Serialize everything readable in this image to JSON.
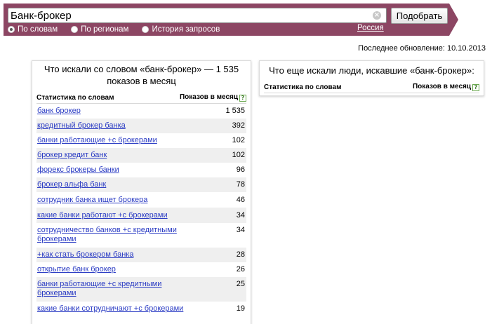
{
  "search": {
    "query": "Банк-брокер",
    "submit_label": "Подобрать",
    "modes": [
      {
        "label": "По словам",
        "selected": true
      },
      {
        "label": "По регионам",
        "selected": false
      },
      {
        "label": "История запросов",
        "selected": false
      }
    ],
    "region": "Россия"
  },
  "updated": "Последнее обновление: 10.10.2013",
  "main_panel": {
    "title": "Что искали со словом «банк-брокер» — 1 535 показов в месяц",
    "col_keywords": "Статистика по словам",
    "col_impressions": "Показов в месяц",
    "rows": [
      {
        "keyword": "банк брокер",
        "count": "1 535"
      },
      {
        "keyword": "кредитный брокер банка",
        "count": "392"
      },
      {
        "keyword": "банки работающие +с брокерами",
        "count": "102"
      },
      {
        "keyword": "брокер кредит банк",
        "count": "102"
      },
      {
        "keyword": "форекс брокеры банки",
        "count": "96"
      },
      {
        "keyword": "брокер альфа банк",
        "count": "78"
      },
      {
        "keyword": "сотрудник банка ищет брокера",
        "count": "46"
      },
      {
        "keyword": "какие банки работают +с брокерами",
        "count": "34"
      },
      {
        "keyword": "сотрудничество банков +с кредитными брокерами",
        "count": "34"
      },
      {
        "keyword": "+как стать брокером банка",
        "count": "28"
      },
      {
        "keyword": "открытие банк брокер",
        "count": "26"
      },
      {
        "keyword": "банки работающие +с кредитными брокерами",
        "count": "25"
      },
      {
        "keyword": "какие банки сотрудничают +с брокерами",
        "count": "19"
      }
    ]
  },
  "side_panel": {
    "title": "Что еще искали люди, искавшие «банк-брокер»:",
    "col_keywords": "Статистика по словам",
    "col_impressions": "Показов в месяц"
  },
  "icons": {
    "clear": "clear-icon",
    "help": "help-icon"
  },
  "colors": {
    "band": "#8c4663",
    "link": "#2b3cc4",
    "row_alt": "#efefef"
  }
}
